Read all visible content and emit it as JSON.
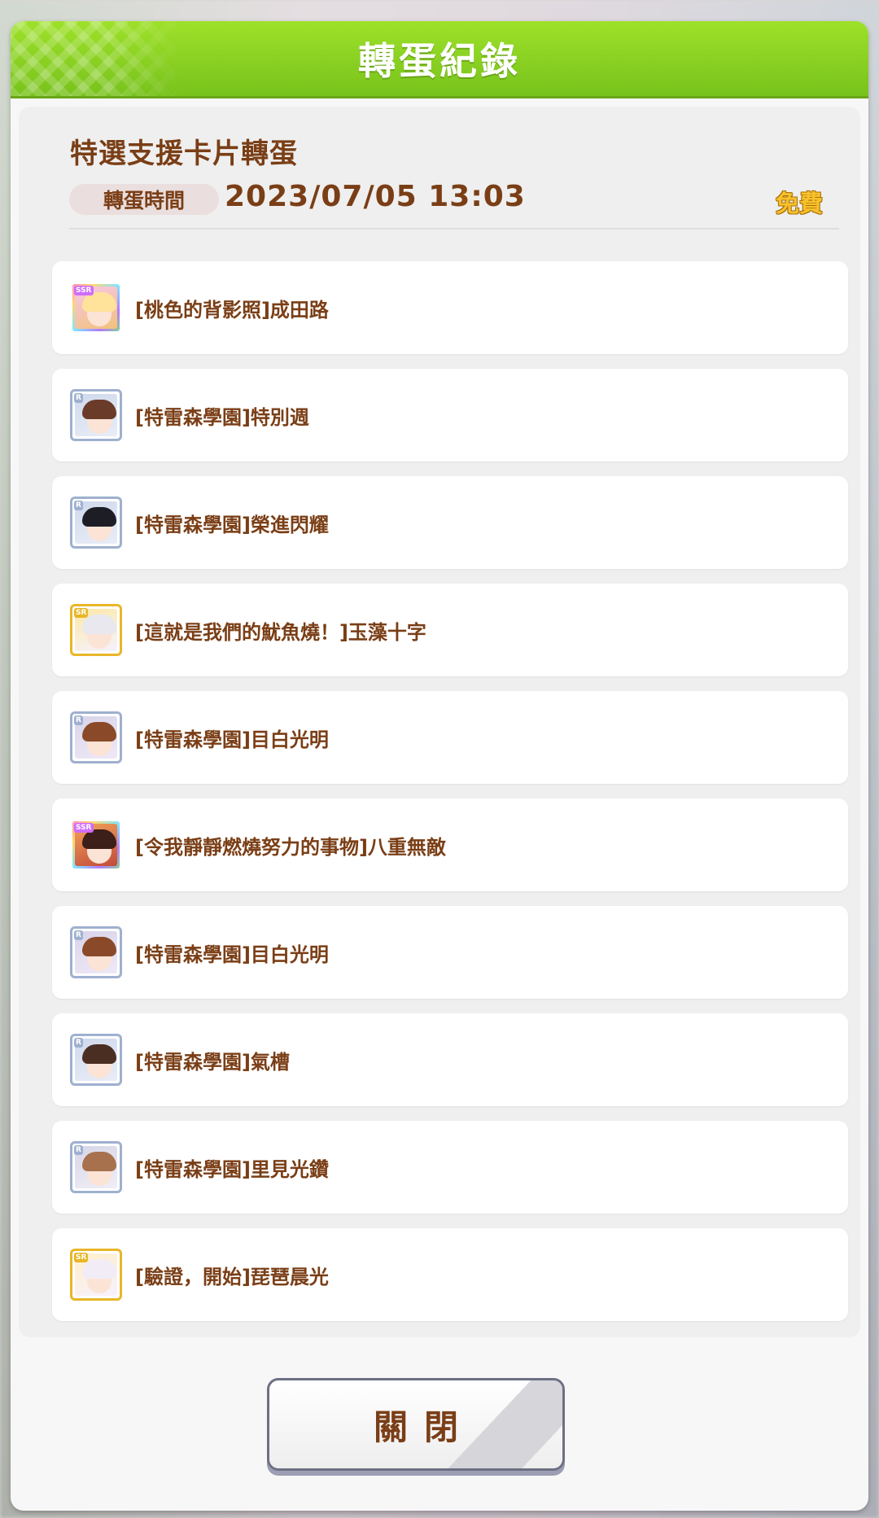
{
  "dialog": {
    "title": "轉蛋紀錄",
    "gacha_name": "特選支援卡片轉蛋",
    "time_label": "轉蛋時間",
    "time_value": "2023/07/05 13:03",
    "cost_label": "免費",
    "close_label": "關閉"
  },
  "results": [
    {
      "rank": "SSR",
      "name": "[桃色的背影照]成田路",
      "icon": "support-card-icon"
    },
    {
      "rank": "R",
      "name": "[特雷森學園]特別週",
      "icon": "support-card-icon"
    },
    {
      "rank": "R",
      "name": "[特雷森學園]榮進閃耀",
      "icon": "support-card-icon"
    },
    {
      "rank": "SR",
      "name": "[這就是我們的魷魚燒！]玉藻十字",
      "icon": "support-card-icon"
    },
    {
      "rank": "R",
      "name": "[特雷森學園]目白光明",
      "icon": "support-card-icon"
    },
    {
      "rank": "SSR",
      "name": "[令我靜靜燃燒努力的事物]八重無敵",
      "icon": "support-card-icon"
    },
    {
      "rank": "R",
      "name": "[特雷森學園]目白光明",
      "icon": "support-card-icon"
    },
    {
      "rank": "R",
      "name": "[特雷森學園]氣槽",
      "icon": "support-card-icon"
    },
    {
      "rank": "R",
      "name": "[特雷森學園]里見光鑽",
      "icon": "support-card-icon"
    },
    {
      "rank": "SR",
      "name": "[驗證，開始]琵琶晨光",
      "icon": "support-card-icon"
    }
  ],
  "colors": {
    "header_green": "#8fd624",
    "text_brown": "#7a3e16",
    "free_gold": "#f7c12c",
    "rank_r": "#9fb0cf",
    "rank_sr": "#e8b628",
    "rank_ssr": "#d06cff"
  }
}
